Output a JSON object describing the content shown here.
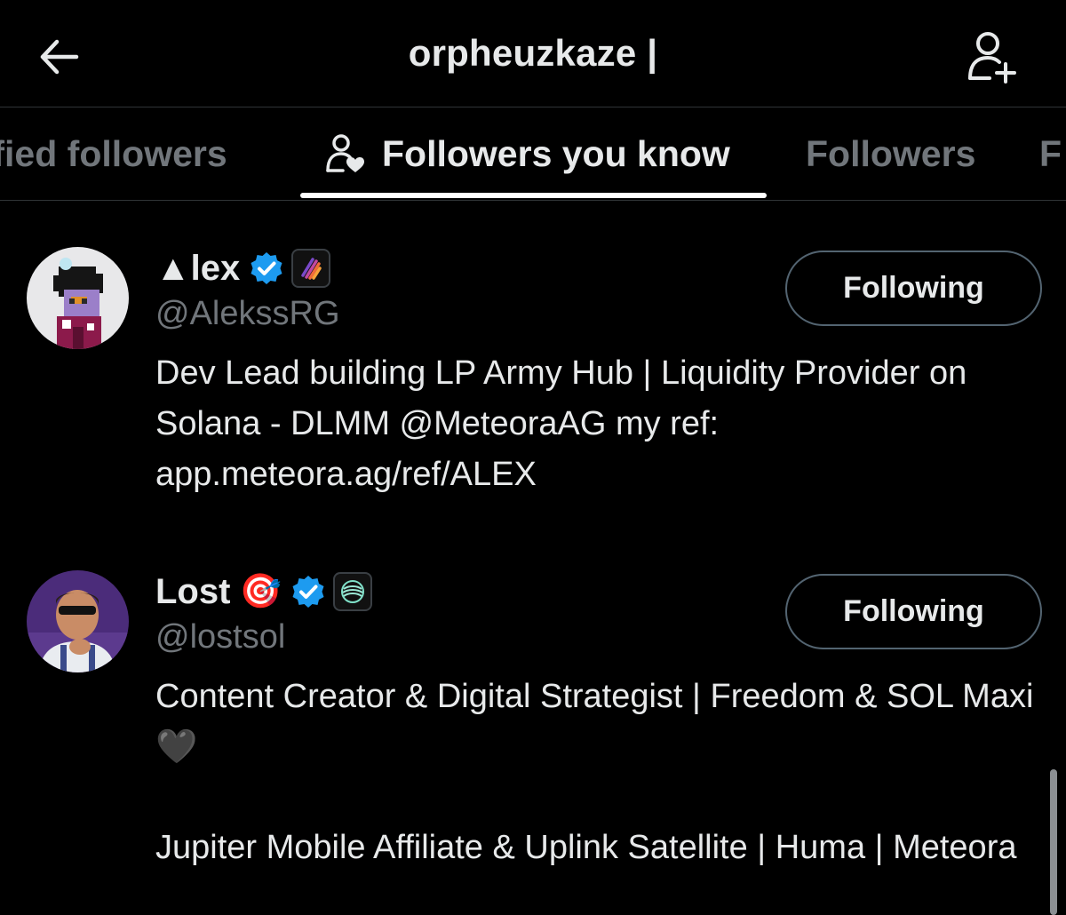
{
  "header": {
    "title": "orpheuzkaze |",
    "back_icon": "arrow-left-icon",
    "add_user_icon": "add-user-icon"
  },
  "tabs": [
    {
      "label": "ified followers",
      "active": false
    },
    {
      "label": "Followers you know",
      "active": true,
      "icon": "people-heart-icon"
    },
    {
      "label": "Followers",
      "active": false
    },
    {
      "label": "F",
      "active": false
    }
  ],
  "users": [
    {
      "name": "▲lex",
      "handle": "@AlekssRG",
      "verified": true,
      "affiliate_badge": "flame-stripes-icon",
      "button_label": "Following",
      "bio": [
        "Dev Lead building LP Army Hub | Liquidity Provider on Solana - DLMM @MeteoraAG my ref: app.meteora.ag/ref/ALEX"
      ]
    },
    {
      "name": "Lost",
      "name_emoji": "🎯",
      "handle": "@lostsol",
      "verified": true,
      "affiliate_badge": "teal-rings-icon",
      "button_label": "Following",
      "bio": [
        "Content Creator & Digital Strategist | Freedom & SOL Maxi 🖤",
        "Jupiter Mobile Affiliate & Uplink Satellite | Huma | Meteora"
      ]
    }
  ],
  "colors": {
    "background": "#000000",
    "text_primary": "#e7e9ea",
    "text_secondary": "#71767b",
    "verified_blue": "#1d9bf0",
    "divider": "#2f3336"
  }
}
